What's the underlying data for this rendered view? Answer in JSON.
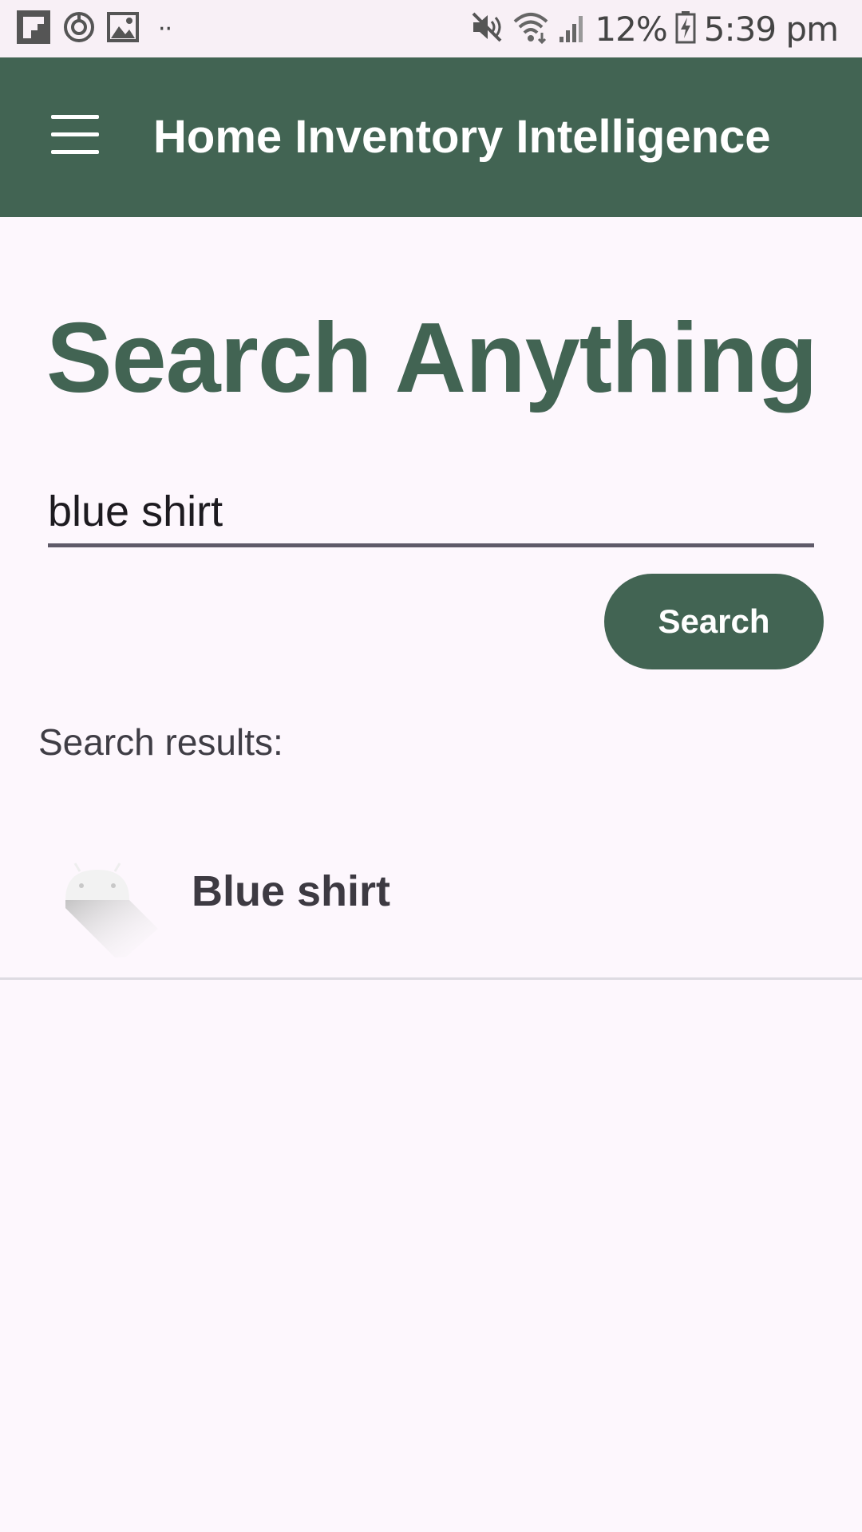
{
  "status_bar": {
    "left_icons": [
      "flipboard-icon",
      "sync-icon",
      "gallery-icon",
      "more-dots-icon"
    ],
    "right_icons": [
      "mute-icon",
      "wifi-icon",
      "signal-icon"
    ],
    "battery_percent": "12%",
    "time": "5:39 pm",
    "more": "··"
  },
  "app_bar": {
    "menu_icon": "hamburger-menu-icon",
    "title": "Home Inventory Intelligence",
    "background_color": "#426453"
  },
  "main": {
    "heading": "Search Anything",
    "search_value": "blue shirt",
    "search_button_label": "Search",
    "results_label": "Search results:",
    "results": [
      {
        "name": "Blue shirt",
        "thumbnail": "android-placeholder-icon"
      }
    ]
  },
  "colors": {
    "accent": "#426453",
    "background": "#fdf7fd"
  }
}
